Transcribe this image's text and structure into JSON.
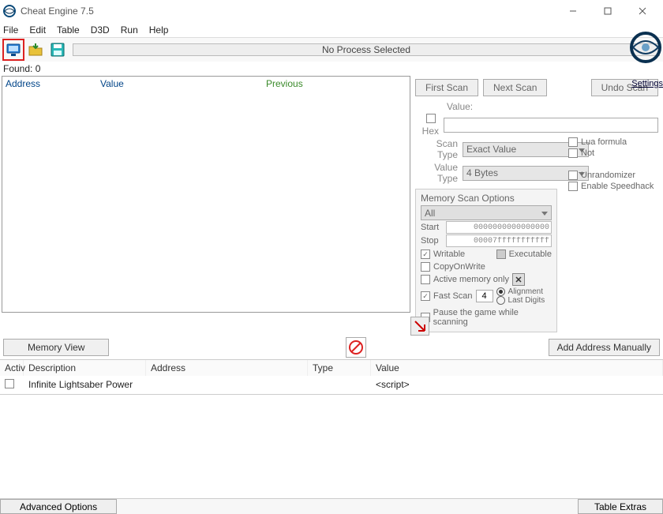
{
  "window": {
    "title": "Cheat Engine 7.5"
  },
  "menu": {
    "file": "File",
    "edit": "Edit",
    "table": "Table",
    "d3d": "D3D",
    "run": "Run",
    "help": "Help"
  },
  "toolbar": {
    "process_status": "No Process Selected"
  },
  "settings_link": "Settings",
  "found": {
    "label": "Found:",
    "count": "0"
  },
  "result_headers": {
    "address": "Address",
    "value": "Value",
    "previous": "Previous"
  },
  "scan": {
    "first_btn": "First Scan",
    "next_btn": "Next Scan",
    "undo_btn": "Undo Scan",
    "value_label": "Value:",
    "hex_label": "Hex",
    "scantype_label": "Scan Type",
    "scantype_value": "Exact Value",
    "valuetype_label": "Value Type",
    "valuetype_value": "4 Bytes",
    "lua_label": "Lua formula",
    "not_label": "Not",
    "unrandomizer": "Unrandomizer",
    "speedhack": "Enable Speedhack"
  },
  "memscan": {
    "title": "Memory Scan Options",
    "region": "All",
    "start_label": "Start",
    "start_value": "0000000000000000",
    "stop_label": "Stop",
    "stop_value": "00007fffffffffff",
    "writable": "Writable",
    "executable": "Executable",
    "copyonwrite": "CopyOnWrite",
    "active_only": "Active memory only",
    "fastscan": "Fast Scan",
    "fastscan_value": "4",
    "alignment": "Alignment",
    "lastdigits": "Last Digits",
    "pause": "Pause the game while scanning"
  },
  "actions": {
    "memory_view": "Memory View",
    "add_manually": "Add Address Manually"
  },
  "table": {
    "headers": {
      "active": "Activ",
      "description": "Description",
      "address": "Address",
      "type": "Type",
      "value": "Value"
    },
    "rows": [
      {
        "description": "Infinite Lightsaber Power",
        "address": "",
        "type": "",
        "value": "<script>"
      }
    ]
  },
  "bottom": {
    "advanced": "Advanced Options",
    "extras": "Table Extras"
  }
}
